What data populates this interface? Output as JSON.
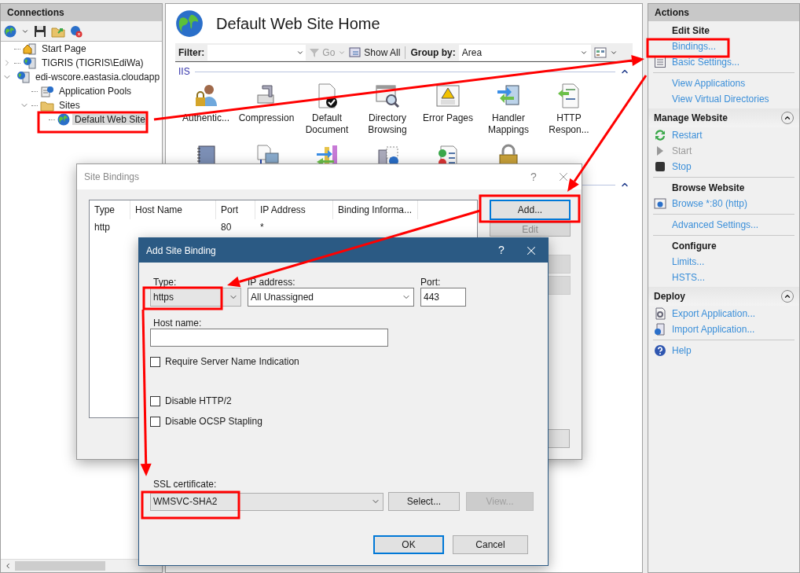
{
  "connections": {
    "title": "Connections",
    "tree": [
      {
        "label": "Start Page",
        "kind": "page",
        "selected": false
      },
      {
        "label": "TIGRIS (TIGRIS\\EdiWa)",
        "kind": "server",
        "expanded": false,
        "selected": false
      },
      {
        "label": "edi-wscore.eastasia.cloudapp",
        "kind": "server",
        "expanded": true,
        "selected": false,
        "children": [
          {
            "label": "Application Pools",
            "kind": "pools",
            "selected": false
          },
          {
            "label": "Sites",
            "kind": "folder",
            "expanded": true,
            "selected": false,
            "children": [
              {
                "label": "Default Web Site",
                "kind": "site",
                "selected": true
              }
            ]
          }
        ]
      }
    ]
  },
  "home": {
    "title": "Default Web Site Home",
    "toolbar": {
      "filter_label": "Filter:",
      "go_label": "Go",
      "go_disabled": true,
      "show_all_label": "Show All",
      "group_by_label": "Group by:",
      "group_by_value": "Area"
    },
    "groups": [
      {
        "title": "IIS",
        "expanded": true,
        "features": [
          {
            "kind": "userlock",
            "label": "Authentic..."
          },
          {
            "kind": "clamp",
            "label": "Compression"
          },
          {
            "kind": "doccheck",
            "label": "Default Document"
          },
          {
            "kind": "browse",
            "label": "Directory Browsing"
          },
          {
            "kind": "warning",
            "label": "Error Pages"
          },
          {
            "kind": "arrows",
            "label": "Handler Mappings"
          },
          {
            "kind": "docarrow",
            "label": "HTTP Respon..."
          },
          {
            "kind": "notebook"
          },
          {
            "kind": "media"
          },
          {
            "kind": "bars"
          },
          {
            "kind": "serverglobe"
          },
          {
            "kind": "checklist"
          },
          {
            "kind": "padlock"
          }
        ]
      },
      {
        "expanded": true
      }
    ]
  },
  "actions": {
    "title": "Actions",
    "blocks": [
      {
        "kind": "plain",
        "rows": [
          {
            "kind": "heading",
            "label": "Edit Site"
          },
          {
            "kind": "link",
            "label": "Bindings...",
            "disabled": false
          },
          {
            "kind": "link",
            "label": "Basic Settings...",
            "disabled": false
          },
          {
            "kind": "divider"
          },
          {
            "kind": "link",
            "label": "View Applications",
            "disabled": false
          },
          {
            "kind": "link",
            "label": "View Virtual Directories",
            "disabled": false
          }
        ]
      },
      {
        "title": "Manage Website",
        "kind": "collapsible",
        "expanded": true,
        "rows": [
          {
            "kind": "link",
            "label": "Restart",
            "disabled": false
          },
          {
            "kind": "link",
            "label": "Start",
            "disabled": true
          },
          {
            "kind": "link",
            "label": "Stop",
            "disabled": false
          },
          {
            "kind": "divider"
          },
          {
            "kind": "heading",
            "label": "Browse Website"
          },
          {
            "kind": "link",
            "label": "Browse *:80 (http)",
            "disabled": false
          },
          {
            "kind": "divider"
          },
          {
            "kind": "link",
            "label": "Advanced Settings...",
            "disabled": false
          },
          {
            "kind": "divider"
          },
          {
            "kind": "heading",
            "label": "Configure"
          },
          {
            "kind": "link",
            "label": "Limits...",
            "disabled": false
          },
          {
            "kind": "link",
            "label": "HSTS...",
            "disabled": false
          }
        ]
      },
      {
        "title": "Deploy",
        "kind": "collapsible",
        "expanded": true,
        "rows": [
          {
            "kind": "link",
            "label": "Export Application...",
            "disabled": false
          },
          {
            "kind": "link",
            "label": "Import Application...",
            "disabled": false
          },
          {
            "kind": "divider"
          },
          {
            "kind": "link",
            "label": "Help",
            "disabled": false
          }
        ]
      }
    ]
  },
  "site_bindings": {
    "title": "Site Bindings",
    "help": "?",
    "columns": [
      {
        "label": "Type"
      },
      {
        "label": "Host Name"
      },
      {
        "label": "Port"
      },
      {
        "label": "IP Address"
      },
      {
        "label": "Binding Informa..."
      }
    ],
    "rows": [
      {
        "type": "http",
        "port": "80",
        "ip_address": "*",
        "selected": false
      }
    ],
    "buttons": [
      {
        "label": "Add...",
        "focused": true,
        "disabled": false
      },
      {
        "label": "Edit",
        "focused": false,
        "disabled": true
      }
    ]
  },
  "add_binding": {
    "title": "Add Site Binding",
    "help": "?",
    "type": {
      "label": "Type:",
      "value": "https"
    },
    "ip_address": {
      "label": "IP address:",
      "value": "All Unassigned"
    },
    "port": {
      "label": "Port:",
      "value": "443"
    },
    "host_name": {
      "label": "Host name:"
    },
    "options": [
      {
        "label": "Require Server Name Indication",
        "checked": false
      },
      {
        "label": "Disable HTTP/2",
        "checked": false
      },
      {
        "label": "Disable OCSP Stapling",
        "checked": false
      }
    ],
    "ssl_certificate": {
      "label": "SSL certificate:",
      "value": "WMSVC-SHA2"
    },
    "certificate_buttons": [
      {
        "label": "Select...",
        "disabled": false
      },
      {
        "label": "View...",
        "disabled": true
      }
    ],
    "buttons": [
      {
        "label": "OK",
        "default": true
      },
      {
        "label": "Cancel",
        "default": false
      }
    ]
  }
}
